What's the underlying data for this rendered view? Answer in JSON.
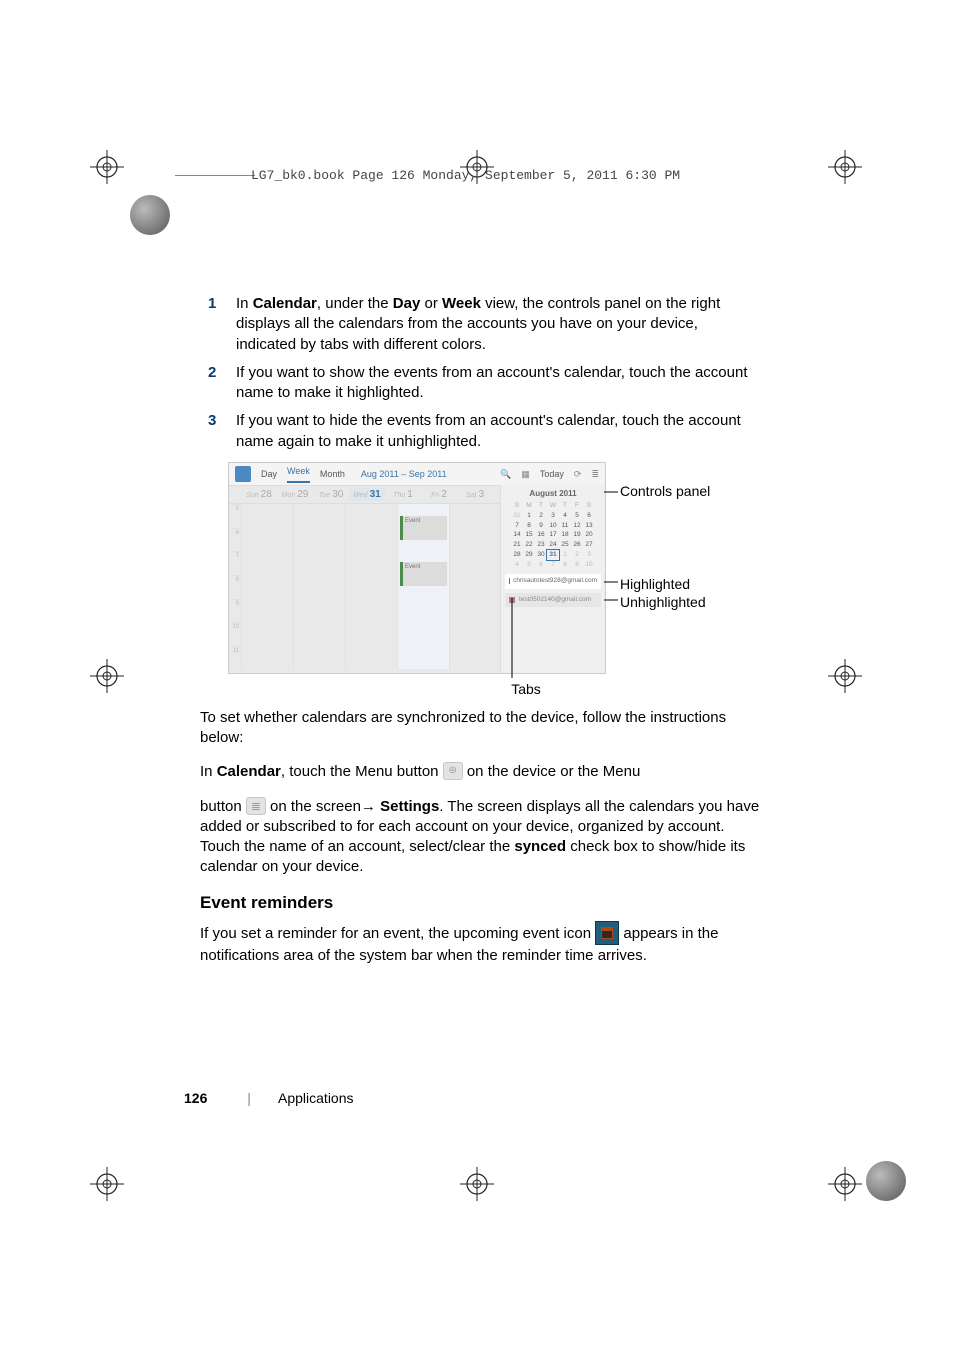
{
  "header_line": "LG7_bk0.book  Page 126  Monday, September 5, 2011  6:30 PM",
  "steps": [
    {
      "num": "1",
      "text_a": "In ",
      "bold_a": "Calendar",
      "text_b": ", under the ",
      "bold_b": "Day",
      "text_c": " or ",
      "bold_c": "Week",
      "text_d": " view, the controls panel on the right displays all the calendars from the accounts you have on your device, indicated by tabs with different colors."
    },
    {
      "num": "2",
      "text": "If you want to show the events from an account's calendar, touch the account name to make it highlighted."
    },
    {
      "num": "3",
      "text": "If you want to hide the events from an account's calendar, touch the account name again to make it unhighlighted."
    }
  ],
  "callouts": {
    "controls_panel": "Controls panel",
    "highlighted": "Highlighted",
    "unhighlighted": "Unhighlighted",
    "tabs": "Tabs"
  },
  "screenshot": {
    "tabs": {
      "day": "Day",
      "week": "Week",
      "month": "Month"
    },
    "range": "Aug 2011 – Sep 2011",
    "today": "Today",
    "days": [
      {
        "lbl": "Sun",
        "num": "28"
      },
      {
        "lbl": "Mon",
        "num": "29"
      },
      {
        "lbl": "Tue",
        "num": "30"
      },
      {
        "lbl": "Wed",
        "num": "31",
        "sel": true
      },
      {
        "lbl": "Thu",
        "num": "1"
      },
      {
        "lbl": "Fri",
        "num": "2"
      },
      {
        "lbl": "Sat",
        "num": "3"
      }
    ],
    "hours": [
      "5",
      "6",
      "7",
      "8",
      "9",
      "10",
      "11"
    ],
    "event_label": "Event",
    "minical": {
      "month": "August 2011",
      "dow": [
        "S",
        "M",
        "T",
        "W",
        "T",
        "F",
        "S"
      ],
      "rows": [
        [
          "31",
          "1",
          "2",
          "3",
          "4",
          "5",
          "6"
        ],
        [
          "7",
          "8",
          "9",
          "10",
          "11",
          "12",
          "13"
        ],
        [
          "14",
          "15",
          "16",
          "17",
          "18",
          "19",
          "20"
        ],
        [
          "21",
          "22",
          "23",
          "24",
          "25",
          "26",
          "27"
        ],
        [
          "28",
          "29",
          "30",
          "31",
          "1",
          "2",
          "3"
        ],
        [
          "4",
          "5",
          "6",
          "7",
          "8",
          "9",
          "10"
        ]
      ]
    },
    "accounts": {
      "highlighted": "chrisautotest928@gmail.com",
      "unhighlighted": "test0502140@gmail.com"
    }
  },
  "sync_para": "To set whether calendars are synchronized to the device, follow the instructions below:",
  "menu_line": {
    "a": "In ",
    "b": "Calendar",
    "c": ", touch the Menu button ",
    "d": " on the device or the Menu"
  },
  "settings_para": {
    "a": "button ",
    "b": " on the screen→ ",
    "c": "Settings",
    "d": ". The screen displays all the calendars you have added or subscribed to for each account on your device, organized by account. Touch the name of an account, select/clear the ",
    "e": "synced",
    "f": " check box to show/hide its calendar on your device."
  },
  "subhead": "Event reminders",
  "reminders_para": {
    "a": "If you set a reminder for an event, the upcoming event icon ",
    "b": " appears in the notifications area of the system bar when the reminder time arrives."
  },
  "footer": {
    "page": "126",
    "section": "Applications"
  }
}
